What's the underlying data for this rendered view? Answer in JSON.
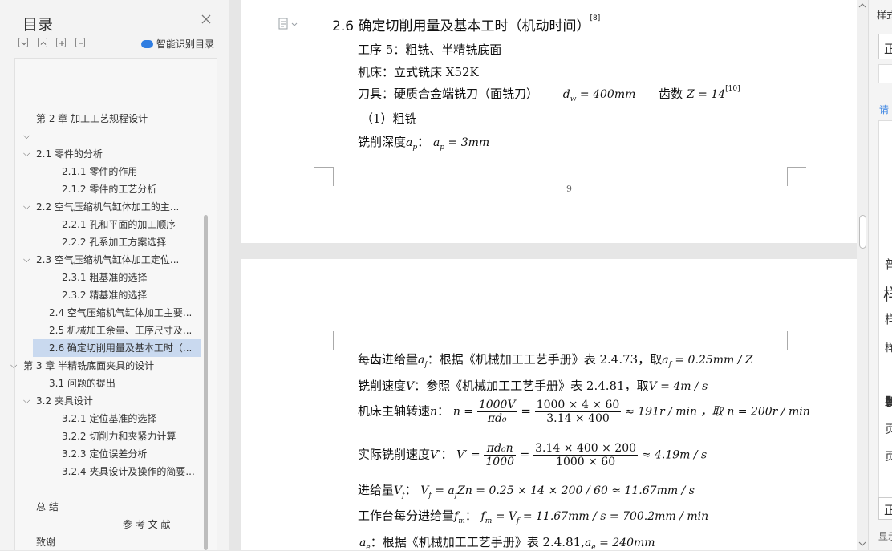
{
  "toc": {
    "title": "目录",
    "smart_label": "智能识别目录",
    "items": [
      {
        "label": "第 2 章  加工工艺规程设计",
        "twisty": ""
      },
      {
        "label": "",
        "twisty": "⌵"
      },
      {
        "label": "2.1  零件的分析",
        "twisty": "⌵"
      },
      {
        "label": "2.1.1  零件的作用",
        "twisty": ""
      },
      {
        "label": "2.1.2  零件的工艺分析",
        "twisty": ""
      },
      {
        "label": "2.2  空气压缩机气缸体加工的主...",
        "twisty": "⌵"
      },
      {
        "label": "2.2.1  孔和平面的加工顺序",
        "twisty": ""
      },
      {
        "label": "2.2.2  孔系加工方案选择",
        "twisty": ""
      },
      {
        "label": "2.3  空气压缩机气缸体加工定位...",
        "twisty": "⌵"
      },
      {
        "label": "2.3.1  粗基准的选择",
        "twisty": ""
      },
      {
        "label": "2.3.2  精基准的选择",
        "twisty": ""
      },
      {
        "label": "2.4  空气压缩机气缸体加工主要...",
        "twisty": ""
      },
      {
        "label": "2.5  机械加工余量、工序尺寸及...",
        "twisty": ""
      },
      {
        "label": "2.6 确定切削用量及基本工时（...",
        "twisty": ""
      },
      {
        "label": "第 3 章  半精铣底面夹具的设计",
        "twisty": "⌵"
      },
      {
        "label": "3.1  问题的提出",
        "twisty": ""
      },
      {
        "label": "3.2  夹具设计",
        "twisty": "⌵"
      },
      {
        "label": "3.2.1  定位基准的选择",
        "twisty": ""
      },
      {
        "label": "3.2.2 切削力和夹紧力计算",
        "twisty": ""
      },
      {
        "label": "3.2.3 定位误差分析",
        "twisty": ""
      },
      {
        "label": "3.2.4 夹具设计及操作的简要...",
        "twisty": ""
      },
      {
        "label": "总  结",
        "twisty": ""
      },
      {
        "label": "参 考 文 献",
        "twisty": ""
      },
      {
        "label": "致谢",
        "twisty": ""
      }
    ]
  },
  "page1": {
    "heading": "2.6 确定切削用量及基本工时（机动时间）",
    "heading_ref": "[8]",
    "line1": "工序 5：粗铣、半精铣底面",
    "line2": "机床：立式铣床 X52K",
    "line3_a": "刀具：硬质合金端铣刀（面铣刀）",
    "line3_math": "d",
    "line3_sub": "w",
    "line3_val": " = 400mm",
    "line3_b": "齿数",
    "line3_c": "Z = 14",
    "line3_ref": "[10]",
    "line4": "（1）粗铣",
    "line5_a": "铣削深度",
    "line5_m1": "a",
    "line5_sub": "p",
    "line5_b": "：",
    "line5_m2": "a",
    "line5_sub2": "p",
    "line5_val": " = 3mm",
    "page_number": "9"
  },
  "page2": {
    "l1_a": "每齿进给量",
    "l1_m": "a",
    "l1_sub": "f",
    "l1_b": "：根据《机械加工工艺手册》表 2.4.73，取",
    "l1_m2": "a",
    "l1_sub2": "f",
    "l1_val": " = 0.25mm / Z",
    "l2_a": "铣削速度",
    "l2_m": "V",
    "l2_b": "：参照《机械加工工艺手册》表 2.4.81，取",
    "l2_val": "V = 4m / s",
    "l3_a": "机床主轴转速",
    "l3_m": "n",
    "l3_b": "：",
    "l3_eq": "n =",
    "l3_f1_num": "1000V",
    "l3_f1_den": "πd₀",
    "l3_f2_num": "1000 × 4 × 60",
    "l3_f2_den": "3.14 × 400",
    "l3_res": "≈ 191r / min ，取",
    "l3_val": "n = 200r / min",
    "l4_a": "实际铣削速度",
    "l4_m": "V′",
    "l4_b": "：",
    "l4_eq": "V′ =",
    "l4_f1_num": "πd₀n",
    "l4_f1_den": "1000",
    "l4_f2_num": "3.14 × 400 × 200",
    "l4_f2_den": "1000 × 60",
    "l4_res": "≈ 4.19m / s",
    "l5_a": "进给量",
    "l5_m": "V",
    "l5_sub": "f",
    "l5_b": "：",
    "l5_eq": "V",
    "l5_eq_sub": "f",
    "l5_rest": " = a",
    "l5_rest_sub": "f",
    "l5_rest2": "Zn = 0.25 × 14 × 200 / 60 ≈ 11.67mm / s",
    "l6_a": "工作台每分进给量",
    "l6_m": "f",
    "l6_sub": "m",
    "l6_b": "：",
    "l6_eq": "f",
    "l6_eq_sub": "m",
    "l6_rest": " = V",
    "l6_rest_sub": "f",
    "l6_rest2": " = 11.67mm / s = 700.2mm / min",
    "l7_m": "a",
    "l7_sub": "e",
    "l7_b": "：根据《机械加工工艺手册》表 2.4.81,",
    "l7_m2": "a",
    "l7_sub2": "e",
    "l7_val": " = 240mm"
  },
  "right": {
    "t1": "样式",
    "t2": "正",
    "t3": "请",
    "t4": "普",
    "t5": "样",
    "t6": "样",
    "t7": "样",
    "t8": "鬟",
    "t9": "页",
    "t10": "页",
    "t11": "正",
    "t12": "显示"
  }
}
